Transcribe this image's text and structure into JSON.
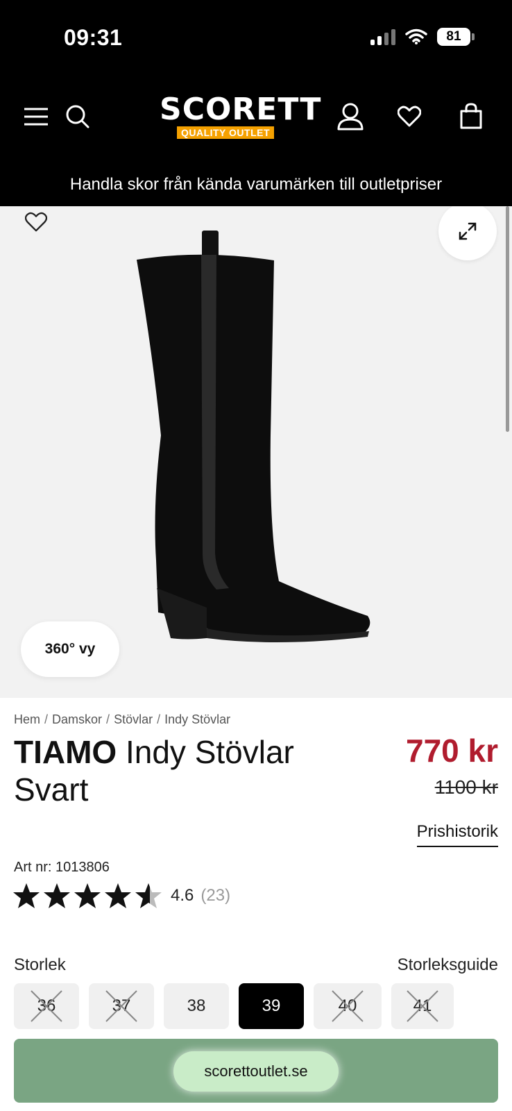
{
  "status_bar": {
    "time": "09:31",
    "battery": "81"
  },
  "header": {
    "logo_text": "SCORETT",
    "logo_badge": "QUALITY OUTLET"
  },
  "promo": {
    "text": "Handla skor från kända varumärken till outletpriser"
  },
  "gallery": {
    "btn_360": "360° vy"
  },
  "breadcrumb": [
    "Hem",
    "Damskor",
    "Stövlar",
    "Indy Stövlar"
  ],
  "product": {
    "brand": "TIAMO",
    "name": "Indy Stövlar",
    "color": "Svart",
    "price": "770 kr",
    "old_price": "1100 kr",
    "price_history": "Prishistorik",
    "art_nr": "Art nr: 1013806",
    "rating": 4.6,
    "rating_score": "4.6",
    "rating_count": "(23)"
  },
  "sizes": {
    "label": "Storlek",
    "guide": "Storleksguide",
    "options": [
      {
        "size": "36",
        "available": false,
        "selected": false
      },
      {
        "size": "37",
        "available": false,
        "selected": false
      },
      {
        "size": "38",
        "available": true,
        "selected": false
      },
      {
        "size": "39",
        "available": true,
        "selected": true
      },
      {
        "size": "40",
        "available": false,
        "selected": false
      },
      {
        "size": "41",
        "available": false,
        "selected": false
      }
    ]
  },
  "browser": {
    "url": "scorettoutlet.se"
  },
  "colors": {
    "price": "#b01c2e",
    "badge": "#f5a100",
    "bottom_bar": "#7aa583"
  }
}
